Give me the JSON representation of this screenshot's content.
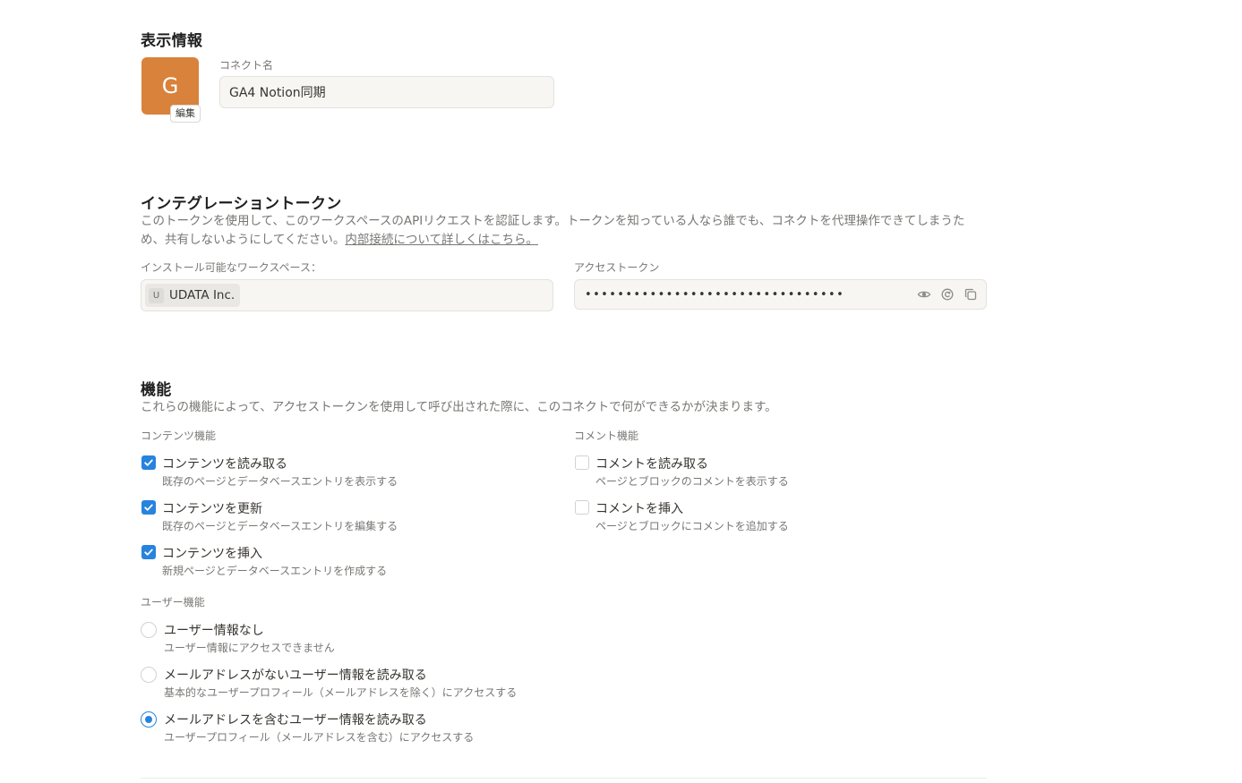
{
  "display_info": {
    "heading": "表示情報",
    "avatar_letter": "G",
    "avatar_color": "#d9823b",
    "edit_label": "編集",
    "name_label": "コネクト名",
    "name_value": "GA4 Notion同期"
  },
  "token": {
    "heading": "インテグレーショントークン",
    "description": "このトークンを使用して、このワークスペースのAPIリクエストを認証します。トークンを知っている人なら誰でも、コネクトを代理操作できてしまうため、共有しないようにしてください。",
    "link_text": "内部接続について詳しくはこちら。",
    "workspace_label": "インストール可能なワークスペース：",
    "workspace_icon_letter": "U",
    "workspace_name": "UDATA Inc.",
    "access_label": "アクセストークン",
    "access_masked": "••••••••••••••••••••••••••••••••",
    "icons": [
      "eye-icon",
      "refresh-icon",
      "copy-icon"
    ]
  },
  "capabilities": {
    "heading": "機能",
    "description": "これらの機能によって、アクセストークンを使用して呼び出された際に、このコネクトで何ができるかが決まります。",
    "content_label": "コンテンツ機能",
    "content": [
      {
        "title": "コンテンツを読み取る",
        "sub": "既存のページとデータベースエントリを表示する",
        "checked": true
      },
      {
        "title": "コンテンツを更新",
        "sub": "既存のページとデータベースエントリを編集する",
        "checked": true
      },
      {
        "title": "コンテンツを挿入",
        "sub": "新規ページとデータベースエントリを作成する",
        "checked": true
      }
    ],
    "comment_label": "コメント機能",
    "comment": [
      {
        "title": "コメントを読み取る",
        "sub": "ページとブロックのコメントを表示する",
        "checked": false
      },
      {
        "title": "コメントを挿入",
        "sub": "ページとブロックにコメントを追加する",
        "checked": false
      }
    ],
    "user_label": "ユーザー機能",
    "user": [
      {
        "title": "ユーザー情報なし",
        "sub": "ユーザー情報にアクセスできません",
        "selected": false
      },
      {
        "title": "メールアドレスがないユーザー情報を読み取る",
        "sub": "基本的なユーザープロフィール（メールアドレスを除く）にアクセスする",
        "selected": false
      },
      {
        "title": "メールアドレスを含むユーザー情報を読み取る",
        "sub": "ユーザープロフィール（メールアドレスを含む）にアクセスする",
        "selected": true
      }
    ],
    "accent_color": "#2783de"
  }
}
